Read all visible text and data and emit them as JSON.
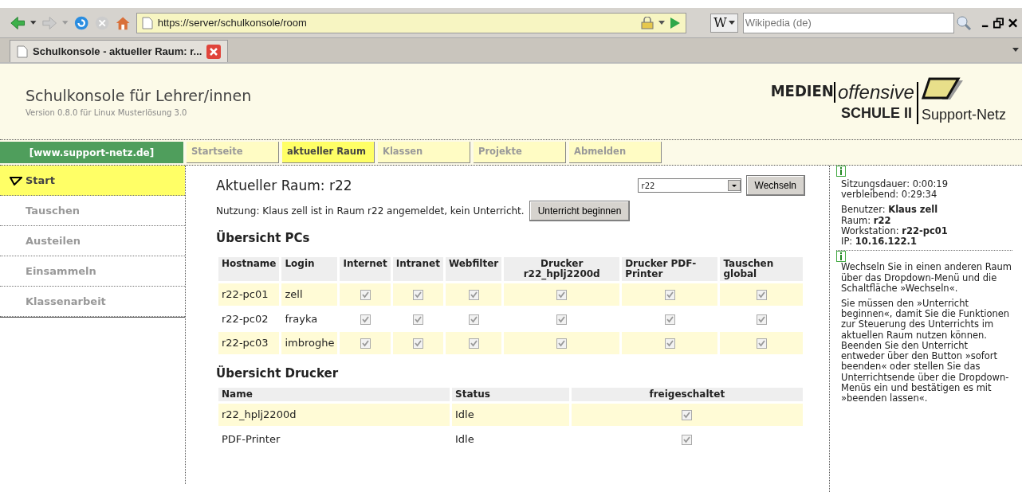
{
  "browser": {
    "url": "https://server/schulkonsole/room",
    "search_engine": "W",
    "search_placeholder": "Wikipedia (de)",
    "tab_title": "Schulkonsole - aktueller Raum: r..."
  },
  "header": {
    "title": "Schulkonsole für Lehrer/innen",
    "subtitle": "Version 0.8.0 für Linux Musterlösung 3.0",
    "logo": [
      "MEDIEN",
      "offensive",
      "SCHULE II",
      "Support-Netz"
    ]
  },
  "nav": {
    "site_link": "[www.support-netz.de]",
    "tabs": [
      {
        "label": "Startseite",
        "selected": false
      },
      {
        "label": "aktueller Raum",
        "selected": true
      },
      {
        "label": "Klassen",
        "selected": false
      },
      {
        "label": "Projekte",
        "selected": false
      },
      {
        "label": "Abmelden",
        "selected": false
      }
    ]
  },
  "sidebar": {
    "items": [
      {
        "label": "Start",
        "selected": true
      },
      {
        "label": "Tauschen",
        "selected": false
      },
      {
        "label": "Austeilen",
        "selected": false
      },
      {
        "label": "Einsammeln",
        "selected": false
      },
      {
        "label": "Klassenarbeit",
        "selected": false
      }
    ]
  },
  "main": {
    "heading": "Aktueller Raum: r22",
    "room_select": "r22",
    "change_button": "Wechseln",
    "usage": "Nutzung: Klaus zell ist in Raum r22 angemeldet, kein Unterricht.",
    "start_button": "Unterricht beginnen",
    "pcs": {
      "title": "Übersicht PCs",
      "columns": [
        "Hostname",
        "Login",
        "Internet",
        "Intranet",
        "Webfilter",
        "Drucker r22_hplj2200d",
        "Drucker PDF-Printer",
        "Tauschen global"
      ],
      "rows": [
        {
          "hostname": "r22-pc01",
          "login": "zell",
          "checks": [
            true,
            true,
            true,
            true,
            true,
            true
          ]
        },
        {
          "hostname": "r22-pc02",
          "login": "frayka",
          "checks": [
            true,
            true,
            true,
            true,
            true,
            true
          ]
        },
        {
          "hostname": "r22-pc03",
          "login": "imbroghe",
          "checks": [
            true,
            true,
            true,
            true,
            true,
            true
          ]
        }
      ]
    },
    "printers": {
      "title": "Übersicht Drucker",
      "columns": [
        "Name",
        "Status",
        "freigeschaltet"
      ],
      "rows": [
        {
          "name": "r22_hplj2200d",
          "status": "Idle",
          "enabled": true
        },
        {
          "name": "PDF-Printer",
          "status": "Idle",
          "enabled": true
        }
      ]
    }
  },
  "info": {
    "session": [
      "Sitzungsdauer: 0:00:19",
      "verbleibend: 0:29:34"
    ],
    "user": [
      "Benutzer: **Klaus zell**",
      "Raum: **r22**",
      "Workstation: **r22-pc01**",
      "IP: **10.16.122.1**"
    ],
    "help": [
      "Wechseln Sie in einen anderen Raum über das Dropdown-Menü und die Schaltfläche »Wechseln«.",
      "Sie müssen den »Unterricht beginnen«, damit Sie die Funktionen zur Steuerung des Unterrichts im aktuellen Raum nutzen können. Beenden Sie den Unterricht entweder über den Button »sofort beenden« oder stellen Sie das Unterrichtsende über die Dropdown-Menüs ein und bestätigen es mit »beenden lassen«."
    ]
  }
}
